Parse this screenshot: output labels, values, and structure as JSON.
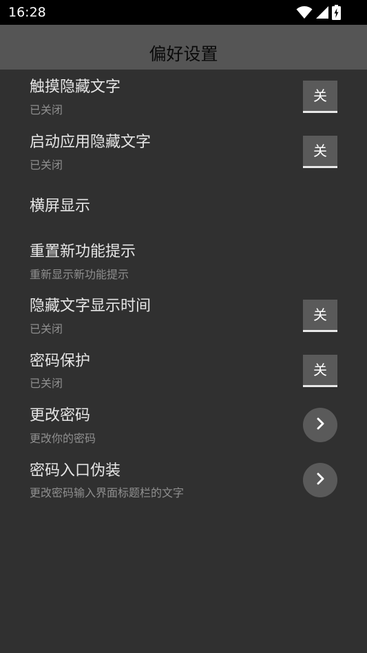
{
  "status_bar": {
    "time": "16:28",
    "icons": [
      "wifi-icon",
      "signal-icon",
      "battery-charging-icon"
    ]
  },
  "app_bar": {
    "title": "偏好设置"
  },
  "settings": {
    "touch_hide": {
      "title": "触摸隐藏文字",
      "subtitle": "已关闭",
      "toggle": "关"
    },
    "launch_hide": {
      "title": "启动应用隐藏文字",
      "subtitle": "已关闭",
      "toggle": "关"
    },
    "landscape": {
      "title": "横屏显示"
    },
    "reset_tips": {
      "title": "重置新功能提示",
      "subtitle": "重新显示新功能提示"
    },
    "hide_time": {
      "title": "隐藏文字显示时间",
      "subtitle": "已关闭",
      "toggle": "关"
    },
    "password_protect": {
      "title": "密码保护",
      "subtitle": "已关闭",
      "toggle": "关"
    },
    "change_password": {
      "title": "更改密码",
      "subtitle": "更改你的密码",
      "action_icon": "chevron-right-icon"
    },
    "disguise": {
      "title": "密码入口伪装",
      "subtitle": "更改密码输入界面标题栏的文字",
      "action_icon": "chevron-right-icon"
    }
  },
  "colors": {
    "background": "#303030",
    "app_bar": "#555555",
    "status_bar": "#000000",
    "title_text": "#e6e6e6",
    "subtitle_text": "#8f8f8f",
    "control_bg": "#5a5a5a"
  }
}
